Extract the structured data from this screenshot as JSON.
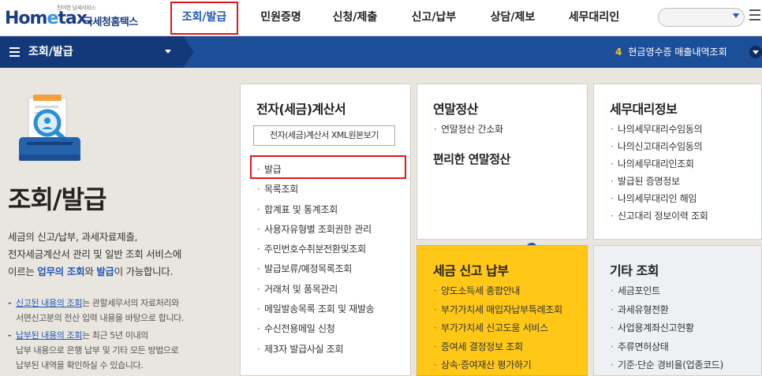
{
  "header": {
    "slogan": "친미한 남세서비스",
    "brand_pre": "Hom",
    "brand_e": "e",
    "brand_post": "tax.",
    "brand_kor": "국세청홈택스",
    "nav": [
      "조회/발급",
      "민원증명",
      "신청/제출",
      "신고/납부",
      "상담/제보",
      "세무대리인"
    ],
    "active_nav": "조회/발급",
    "search_placeholder": ""
  },
  "subbar": {
    "title": "조회/발급",
    "notice_num": "4",
    "notice_text": "현금영수증 매출내역조회"
  },
  "intro": {
    "title": "조회/발급",
    "desc_1": "세금의 신고/납부, 과세자료제출,",
    "desc_2": "전자세금계산서 관리 및 일반 조회 서비스에",
    "desc_3_pre": "이르는 ",
    "desc_3_em1": "업무의 조회",
    "desc_3_mid": "와 ",
    "desc_3_em2": "발급",
    "desc_3_post": "이 가능합니다.",
    "bullet1_u": "신고된 내용의 조회",
    "bullet1_l1": "는 관할세무서의 자료처리와",
    "bullet1_l2": "서면신고분의 전산 입력 내용을 바탕으로 합니다.",
    "bullet2_u": "납부된 내용의 조회",
    "bullet2_l1": "는 최근 5년 이내의",
    "bullet2_l2": "납부 내용으로 은행 납부 및 기타 모든 방법으로",
    "bullet2_l3": "납부된 내역을 확인하실 수 있습니다."
  },
  "cards": {
    "einvoice": {
      "title": "전자(세금)계산서",
      "button": "전자(세금)계산서 XML원본보기",
      "items": [
        "발급",
        "목록조회",
        "합계표 및 통계조회",
        "사용자유형별 조회권한 관리",
        "주민번호수취분전환및조회",
        "발급보류/예정목록조회",
        "거래처 및 품목관리",
        "메일발송목록 조회 및 재발송",
        "수신전용메일 신청",
        "제3자 발급사실 조회"
      ]
    },
    "yearend": {
      "title": "연말정산",
      "items": [
        "연말정산 간소화"
      ],
      "sub": "편리한 연말정산"
    },
    "agent": {
      "title": "세무대리정보",
      "items": [
        "나의세무대리수임동의",
        "나의신고대리수임동의",
        "나의세무대리인조회",
        "발급된 증명정보",
        "나의세무대리인 해임",
        "신고대리 정보이력 조회"
      ]
    },
    "taxfiling": {
      "title": "세금 신고 납부",
      "items": [
        "양도소득세 종합안내",
        "부가가치세 매입자납부특례조회",
        "부가가치세 신고도움 서비스",
        "증여세 결정정보 조회",
        "상속·증여재산 평가하기"
      ]
    },
    "other": {
      "title": "기타 조회",
      "items": [
        "세금포인트",
        "과세유형전환",
        "사업용계좌신고현황",
        "주류면허상태",
        "기준·단순 경비율(업종코드)"
      ]
    }
  },
  "colors": {
    "brand_blue": "#1c3d84",
    "subbar_blue": "#1d4f98",
    "highlight_red": "#e0171a",
    "yellow_card": "#ffc817"
  }
}
